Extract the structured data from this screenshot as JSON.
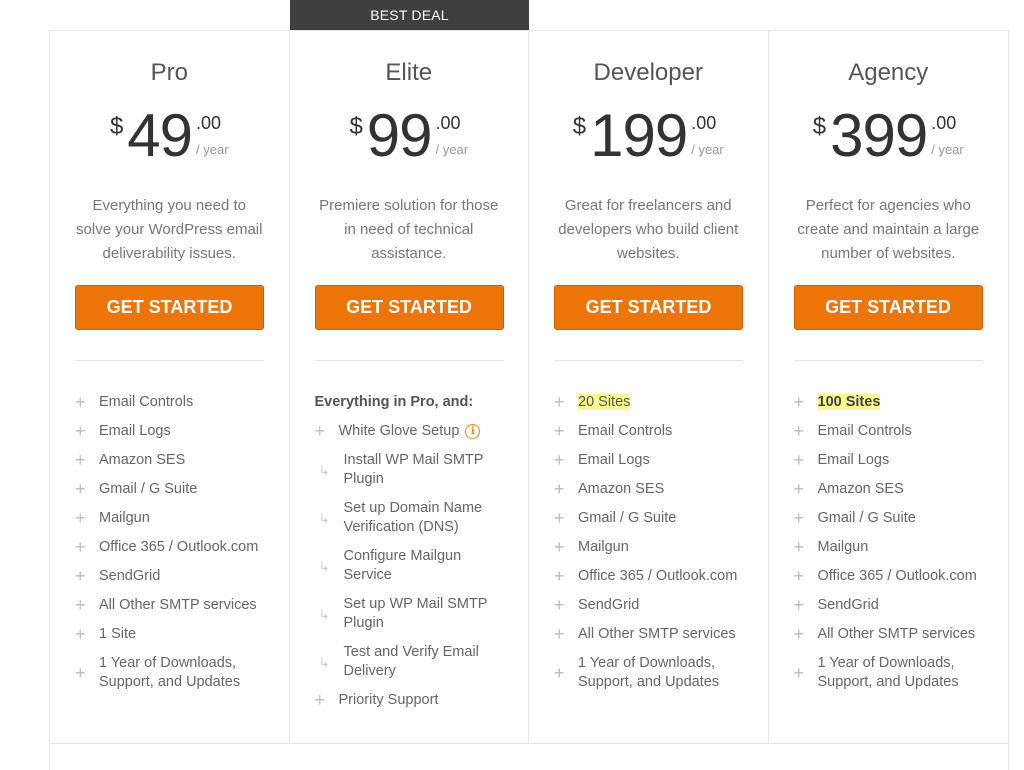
{
  "badge": "BEST DEAL",
  "plans": [
    {
      "name": "Pro",
      "currency": "$",
      "price": "49",
      "cents": ".00",
      "period": "/ year",
      "description": "Everything you need to solve your WordPress email deliverability issues.",
      "button": "GET STARTED",
      "features": [
        "Email Controls",
        "Email Logs",
        "Amazon SES",
        "Gmail / G Suite",
        "Mailgun",
        "Office 365 / Outlook.com",
        "SendGrid",
        "All Other SMTP services",
        "1 Site",
        "1 Year of Downloads, Support, and Updates"
      ]
    },
    {
      "name": "Elite",
      "currency": "$",
      "price": "99",
      "cents": ".00",
      "period": "/ year",
      "description": "Premiere solution for those in need of technical assistance.",
      "button": "GET STARTED",
      "intro": "Everything in Pro, and:",
      "white_glove": "White Glove Setup",
      "info_icon": "i",
      "sub_features": [
        "Install WP Mail SMTP Plugin",
        "Set up Domain Name Verification (DNS)",
        "Configure Mailgun Service",
        "Set up WP Mail SMTP Plugin",
        "Test and Verify Email Delivery"
      ],
      "priority": "Priority Support"
    },
    {
      "name": "Developer",
      "currency": "$",
      "price": "199",
      "cents": ".00",
      "period": "/ year",
      "description": "Great for freelancers and developers who build client websites.",
      "button": "GET STARTED",
      "highlight": "20 Sites",
      "features": [
        "Email Controls",
        "Email Logs",
        "Amazon SES",
        "Gmail / G Suite",
        "Mailgun",
        "Office 365 / Outlook.com",
        "SendGrid",
        "All Other SMTP services",
        "1 Year of Downloads, Support, and Updates"
      ]
    },
    {
      "name": "Agency",
      "currency": "$",
      "price": "399",
      "cents": ".00",
      "period": "/ year",
      "description": "Perfect for agencies who create and maintain a large number of websites.",
      "button": "GET STARTED",
      "highlight": "100 Sites",
      "features": [
        "Email Controls",
        "Email Logs",
        "Amazon SES",
        "Gmail / G Suite",
        "Mailgun",
        "Office 365 / Outlook.com",
        "SendGrid",
        "All Other SMTP services",
        "1 Year of Downloads, Support, and Updates"
      ]
    }
  ],
  "icons": {
    "plus": "+",
    "sub_arrow": "↳"
  },
  "colors": {
    "button": "#ed7406",
    "badge": "#3f3f3f",
    "highlight": "#fafa8c",
    "info": "#e98a1c"
  }
}
